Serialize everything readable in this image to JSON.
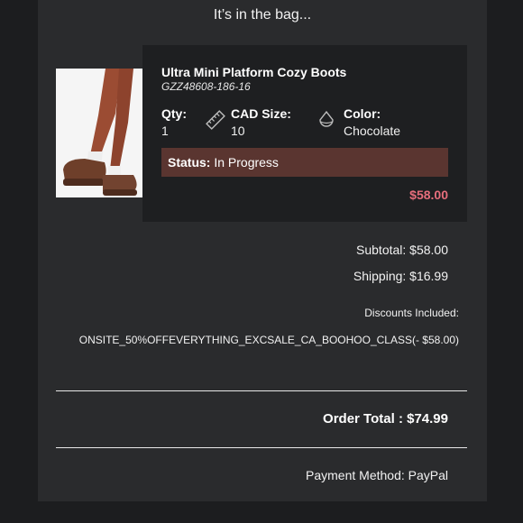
{
  "header": {
    "title": "It’s in the bag..."
  },
  "item": {
    "name": "Ultra Mini Platform Cozy Boots",
    "sku": "GZZ48608-186-16",
    "qty_label": "Qty:",
    "qty_value": "1",
    "size_label": "CAD Size:",
    "size_value": "10",
    "color_label": "Color:",
    "color_value": "Chocolate",
    "status_label": "Status:",
    "status_value": "In Progress",
    "price": "$58.00",
    "icons": [
      "ruler-icon",
      "color-drop-icon"
    ]
  },
  "summary": {
    "subtotal": "Subtotal: $58.00",
    "shipping": "Shipping: $16.99",
    "discounts_label": "Discounts Included:",
    "discount_code": "ONSITE_50%OFFEVERYTHING_EXCSALE_CA_BOOHOO_CLASS(- $58.00)",
    "order_total": "Order Total : $74.99",
    "payment": "Payment Method: PayPal"
  },
  "colors": {
    "status_bg": "#5a3530",
    "price": "#e66e7c",
    "card_bg": "#1e1f21",
    "panel_bg": "#2a2b2d"
  }
}
